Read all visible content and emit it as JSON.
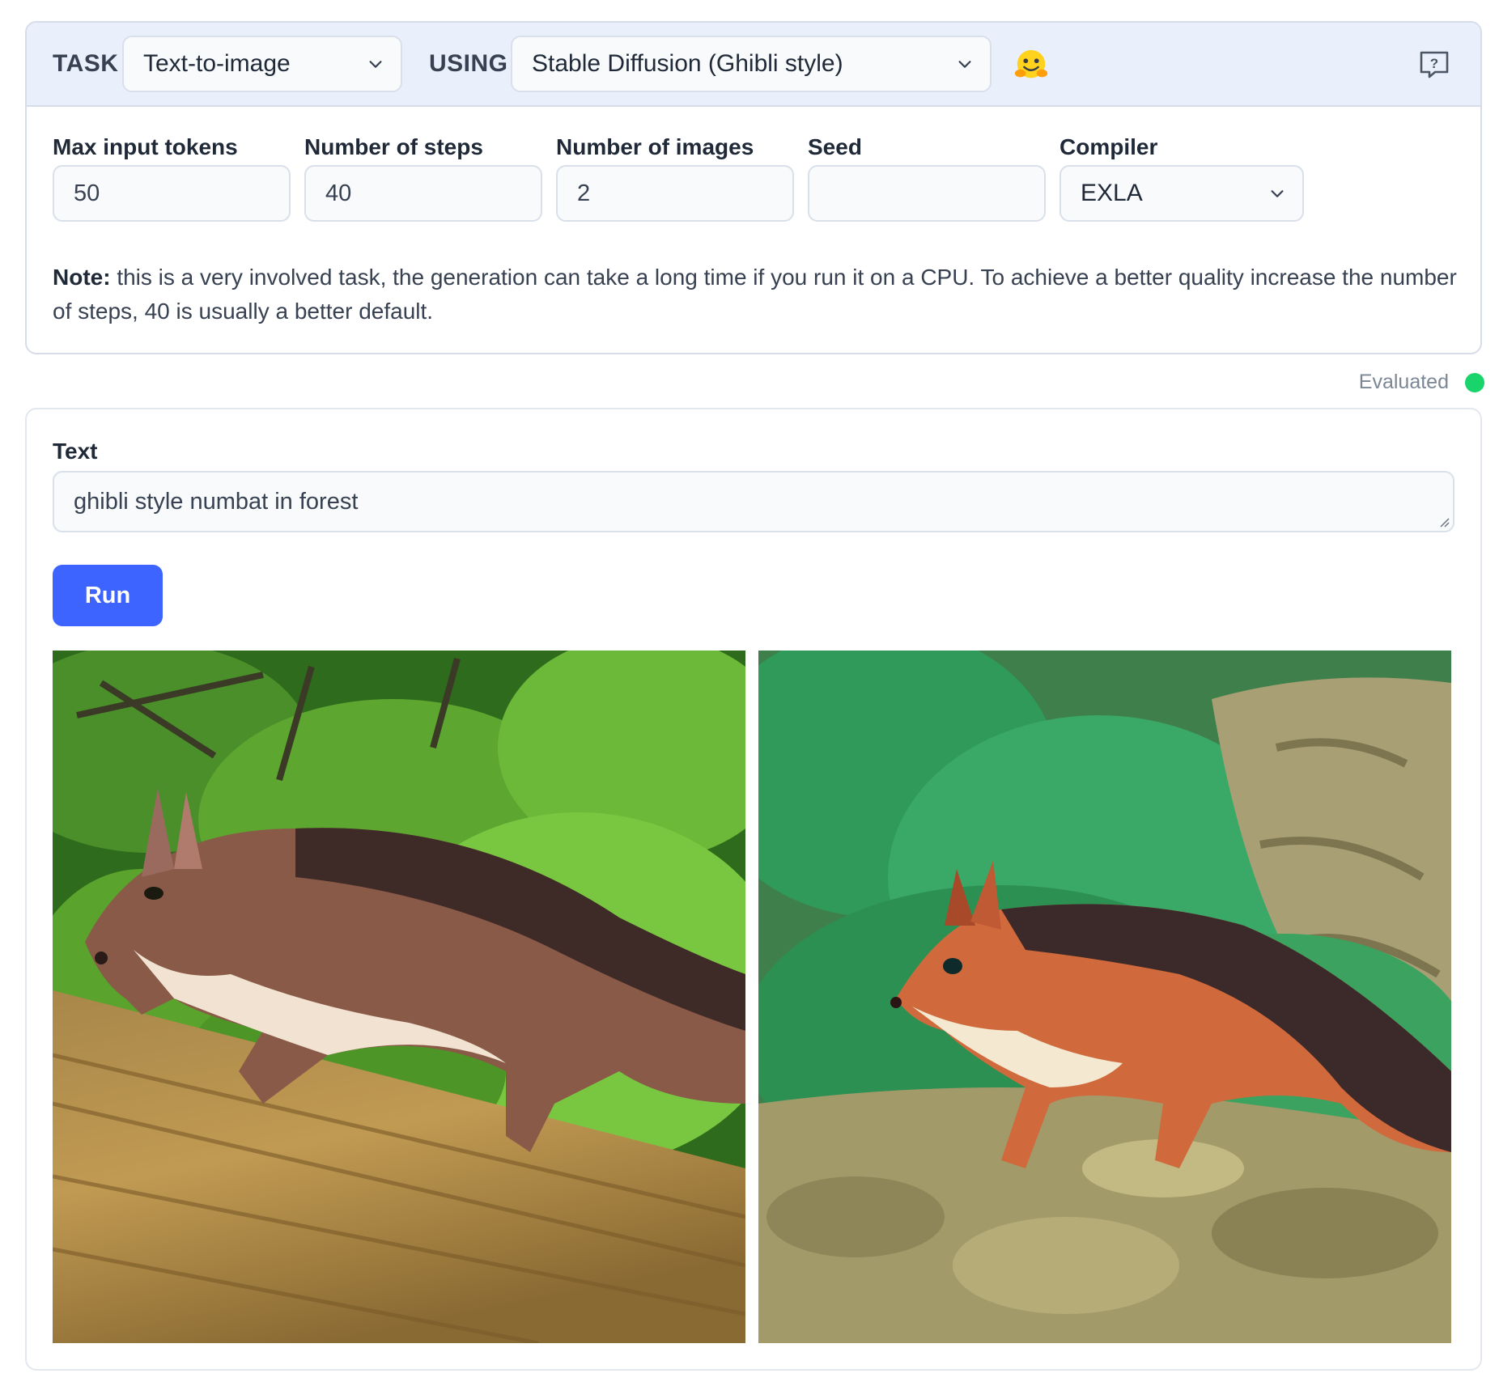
{
  "header": {
    "task_label": "TASK",
    "task_value": "Text-to-image",
    "using_label": "USING",
    "using_value": "Stable Diffusion (Ghibli style)",
    "hf_icon": "hugging-face-icon",
    "help_icon": "help-icon"
  },
  "params": {
    "max_tokens": {
      "label": "Max input tokens",
      "value": "50"
    },
    "steps": {
      "label": "Number of steps",
      "value": "40"
    },
    "images": {
      "label": "Number of images",
      "value": "2"
    },
    "seed": {
      "label": "Seed",
      "value": ""
    },
    "compiler": {
      "label": "Compiler",
      "value": "EXLA"
    }
  },
  "note": {
    "bold": "Note:",
    "text": " this is a very involved task, the generation can take a long time if you run it on a CPU. To achieve a better quality increase the number of steps, 40 is usually a better default."
  },
  "status": {
    "text": "Evaluated",
    "color": "#19d36b"
  },
  "output": {
    "text_label": "Text",
    "text_value": "ghibli style numbat in forest",
    "run_label": "Run",
    "accent": "#3e64ff"
  }
}
